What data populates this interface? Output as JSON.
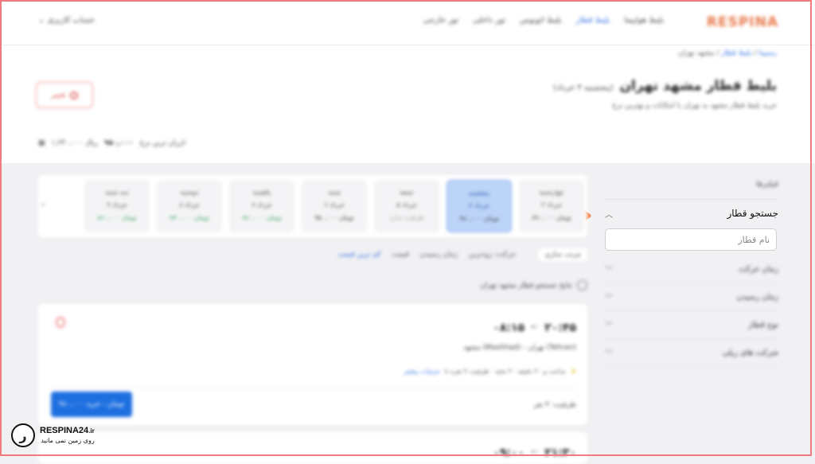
{
  "header": {
    "logo": "RESPINA",
    "nav": [
      "بلیط هواپیما",
      "بلیط قطار",
      "بلیط اتوبوس",
      "تور داخلی",
      "تور خارجی"
    ],
    "active_nav_index": 1,
    "user_label": "حساب کاربری"
  },
  "breadcrumb": {
    "home": "رسپینا",
    "section": "بلیط قطار",
    "current": "مشهد تهران"
  },
  "page": {
    "title": "بلیط قطار مشهد تهران",
    "title_sub": "(پنجشنبه ۴ خرداد)",
    "description": "خرید بلیط قطار مشهد به تهران با امکانات و بهترین نرخ",
    "edit_label": "تغییر",
    "price_label": "ارزان ترین نرخ:",
    "price_value": "۹۸۰,۰۰۰",
    "price_extra": "۱,۲۴۰,۰۰۰ ریال"
  },
  "sidebar": {
    "title": "فیلترها",
    "active_filter": "جستجو قطار",
    "input_placeholder": "نام قطار",
    "filters": [
      "زمان حرکت",
      "زمان رسیدن",
      "نوع قطار",
      "شرکت های ریلی"
    ]
  },
  "date_strip": {
    "days": [
      {
        "day": "چهارشنبه",
        "date": "۳ خرداد",
        "price": "۸۹۰,۰۰۰ تومان",
        "tone": "normal"
      },
      {
        "day": "پنجشنبه",
        "date": "۴ خرداد",
        "price": "۹۸۰,۰۰۰ تومان",
        "tone": "normal"
      },
      {
        "day": "جمعه",
        "date": "۵ خرداد",
        "price": "ظرفیت ندارد",
        "tone": "gray"
      },
      {
        "day": "شنبه",
        "date": "۶ خرداد",
        "price": "۹۵۰,۰۰۰ تومان",
        "tone": "normal"
      },
      {
        "day": "یکشنبه",
        "date": "۷ خرداد",
        "price": "۸۷۰,۰۰۰ تومان",
        "tone": "green"
      },
      {
        "day": "دوشنبه",
        "date": "۸ خرداد",
        "price": "۸۴۰,۰۰۰ تومان",
        "tone": "green"
      },
      {
        "day": "سه شنبه",
        "date": "۹ خرداد",
        "price": "۸۶۰,۰۰۰ تومان",
        "tone": "green"
      }
    ],
    "selected_index": 1,
    "prev_arrow": "‹"
  },
  "sort": {
    "button": "مرتب سازی",
    "options": [
      "حرکت: زودترین",
      "زمان رسیدن",
      "قیمت",
      "کم ترین قیمت"
    ]
  },
  "notice": "نتایج جستجو قطار مشهد تهران",
  "cards": [
    {
      "depart": "۲۰:۴۵",
      "arrive": "۰۸:۱۵",
      "arrow": "←",
      "route": "مشهد (Mashhad) - تهران (Tehran)",
      "info_rating": "★",
      "info": "۸ ساعت و ۳۰ دقیقه · ۳ تخته · ظرفیت ۴ نفره",
      "info_link": "جزئیات بیشتر",
      "capacity": "ظرفیت: ۴ نفر",
      "buy_label": "۹۸۰,۰۰۰ تومان - خرید"
    },
    {
      "depart": "۲۱:۳۰",
      "arrive": "۰۹:۰۰",
      "arrow": "←"
    }
  ],
  "watermark": {
    "brand": "RESPINA24",
    "domain": ".ir",
    "tagline": "روی زمین نمی مانید",
    "mark": "ر"
  }
}
